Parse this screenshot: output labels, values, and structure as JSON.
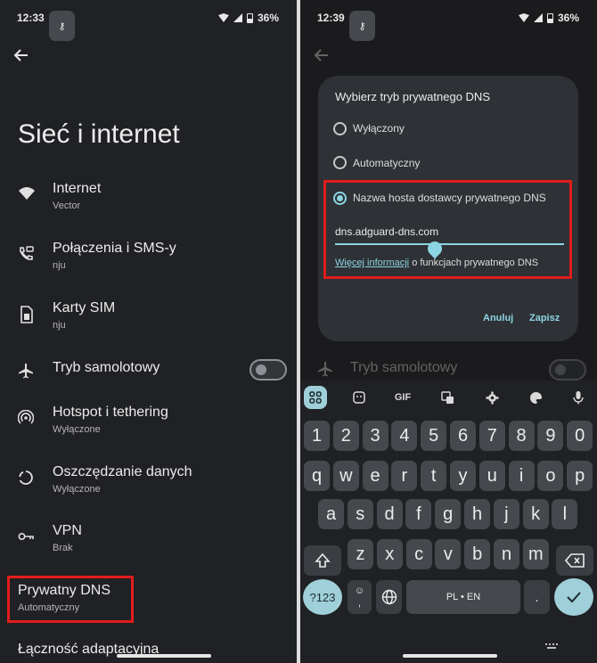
{
  "left": {
    "status": {
      "time": "12:33",
      "battery": "36%"
    },
    "title": "Sieć i internet",
    "items": [
      {
        "label": "Internet",
        "sub": "Vector",
        "icon": "wifi-icon"
      },
      {
        "label": "Połączenia i SMS-y",
        "sub": "nju",
        "icon": "call-sms-icon"
      },
      {
        "label": "Karty SIM",
        "sub": "nju",
        "icon": "sim-card-icon"
      },
      {
        "label": "Tryb samolotowy",
        "sub": "",
        "icon": "airplane-icon"
      },
      {
        "label": "Hotspot i tethering",
        "sub": "Wyłączone",
        "icon": "hotspot-icon"
      },
      {
        "label": "Oszczędzanie danych",
        "sub": "Wyłączone",
        "icon": "data-saver-icon"
      },
      {
        "label": "VPN",
        "sub": "Brak",
        "icon": "vpn-key-icon"
      },
      {
        "label": "Prywatny DNS",
        "sub": "Automatyczny",
        "icon": ""
      },
      {
        "label": "Łączność adaptacyjna",
        "sub": "",
        "icon": ""
      }
    ],
    "airplane_toggle_on": false,
    "highlight_color": "#e21c1c"
  },
  "right": {
    "status": {
      "time": "12:39",
      "battery": "36%"
    },
    "dialog": {
      "title": "Wybierz tryb prywatnego DNS",
      "options": [
        "Wyłączony",
        "Automatyczny",
        "Nazwa hosta dostawcy prywatnego DNS"
      ],
      "selected_index": 2,
      "hostname_value": "dns.adguard-dns.com",
      "info_link": "Więcej informacji",
      "info_rest": " o funkcjach prywatnego DNS",
      "cancel": "Anuluj",
      "save": "Zapisz"
    },
    "behind_item": "Tryb samolotowy",
    "keyboard": {
      "toolbar": [
        "apps-grid-icon",
        "sticker-icon",
        "GIF",
        "translate-icon",
        "gear-icon",
        "palette-icon",
        "mic-icon"
      ],
      "gif_label": "GIF",
      "row1": [
        "1",
        "2",
        "3",
        "4",
        "5",
        "6",
        "7",
        "8",
        "9",
        "0"
      ],
      "row2": [
        "q",
        "w",
        "e",
        "r",
        "t",
        "y",
        "u",
        "i",
        "o",
        "p"
      ],
      "row3": [
        "a",
        "s",
        "d",
        "f",
        "g",
        "h",
        "j",
        "k",
        "l"
      ],
      "row4": [
        "z",
        "x",
        "c",
        "v",
        "b",
        "n",
        "m"
      ],
      "symbols": "?123",
      "comma": ",",
      "emoji": "☺",
      "space": "PL • EN",
      "period": ".",
      "shift_icon": "shift-icon",
      "backspace_icon": "backspace-icon",
      "enter_icon": "check-icon",
      "accent": "#9fcfd9"
    }
  }
}
